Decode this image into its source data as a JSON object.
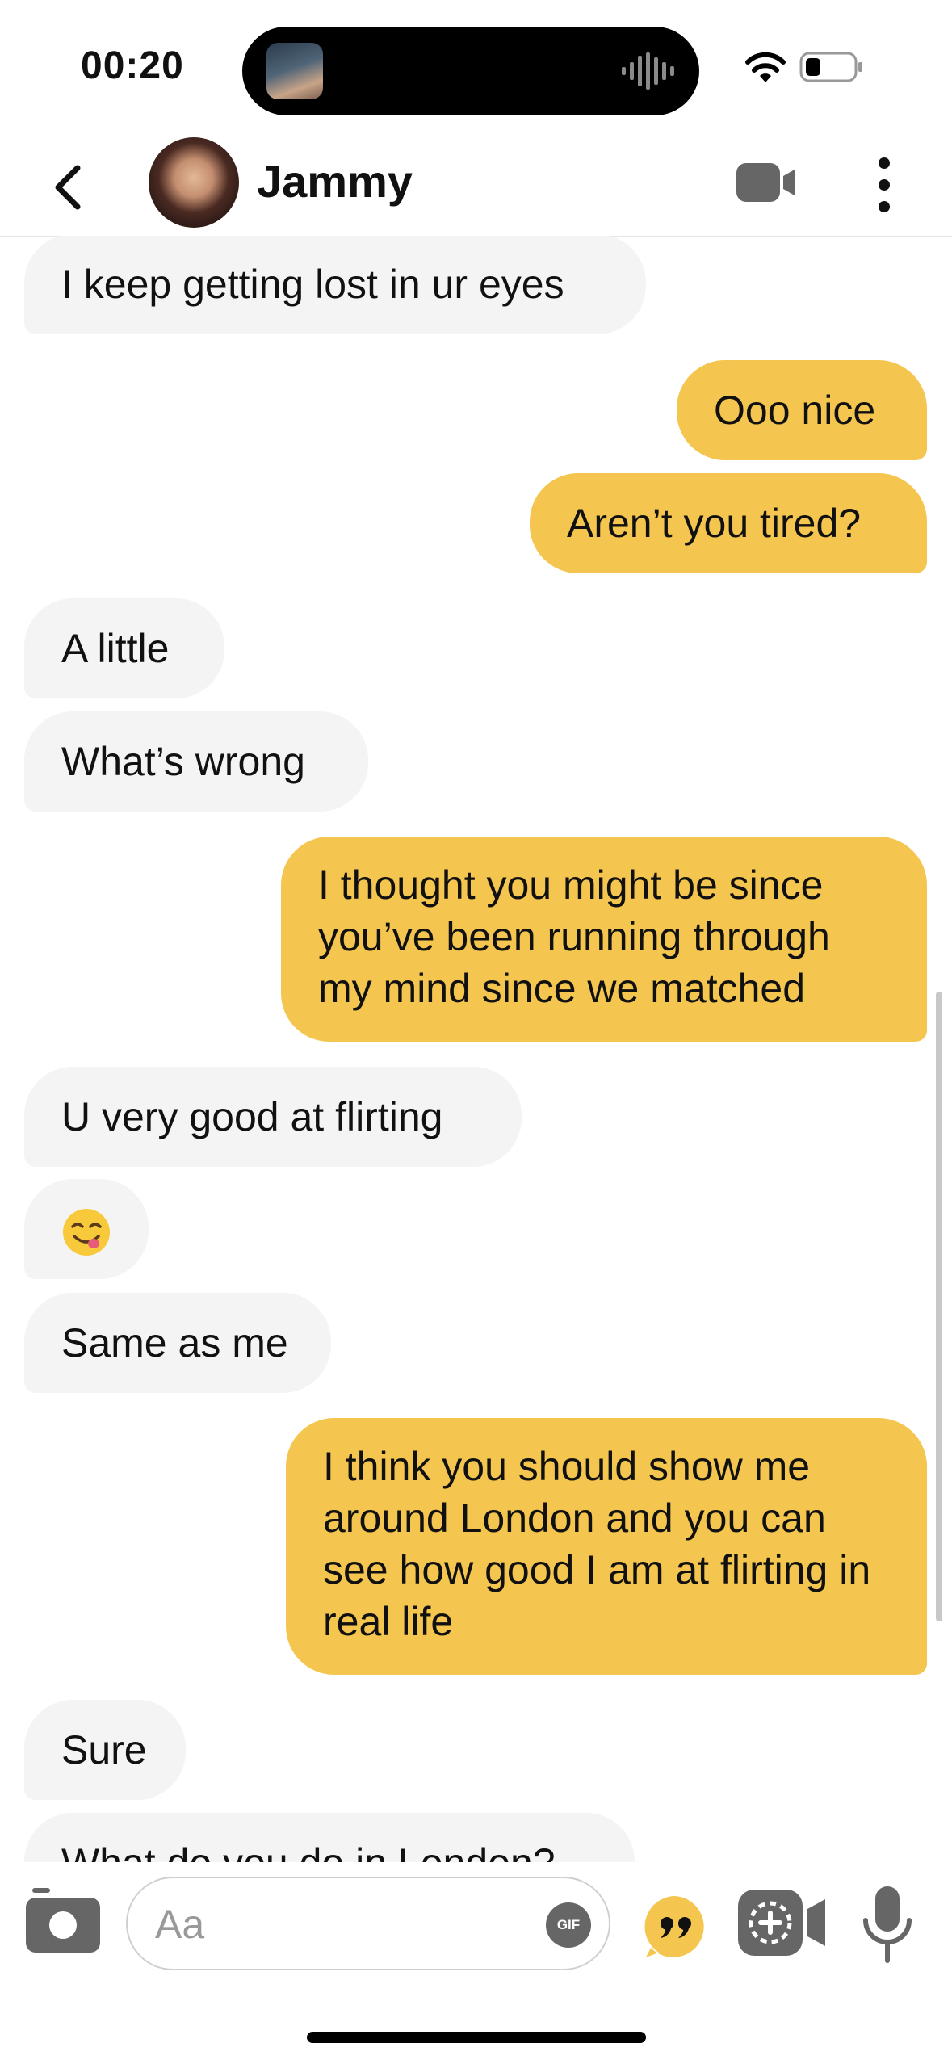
{
  "status": {
    "time": "00:20"
  },
  "header": {
    "contact_name": "Jammy"
  },
  "messages": [
    {
      "side": "in",
      "text": "I keep getting lost in ur eyes"
    },
    {
      "side": "out",
      "text": "Ooo nice"
    },
    {
      "side": "out",
      "text": "Aren’t you tired?"
    },
    {
      "side": "in",
      "text": "A little"
    },
    {
      "side": "in",
      "text": "What’s wrong"
    },
    {
      "side": "out",
      "text": "I thought you might be since you’ve been running through my mind since we matched"
    },
    {
      "side": "in",
      "text": "U very good at flirting"
    },
    {
      "side": "in",
      "text": "😋"
    },
    {
      "side": "in",
      "text": "Same as me"
    },
    {
      "side": "out",
      "text": "I think you should show me around London and you can see how good I am at flirting in real life"
    },
    {
      "side": "in",
      "text": "Sure"
    },
    {
      "side": "in",
      "text": "What do you do in London?"
    }
  ],
  "composer": {
    "placeholder": "Aa",
    "gif_label": "GIF"
  },
  "colors": {
    "outgoing": "#f5c64f",
    "incoming": "#f4f4f4",
    "accent": "#f5c64f"
  },
  "icons": [
    "back-chevron-icon",
    "video-camera-icon",
    "more-vertical-icon",
    "camera-icon",
    "gif-icon",
    "quote-icon",
    "add-video-icon",
    "microphone-icon",
    "wifi-icon",
    "battery-icon"
  ]
}
